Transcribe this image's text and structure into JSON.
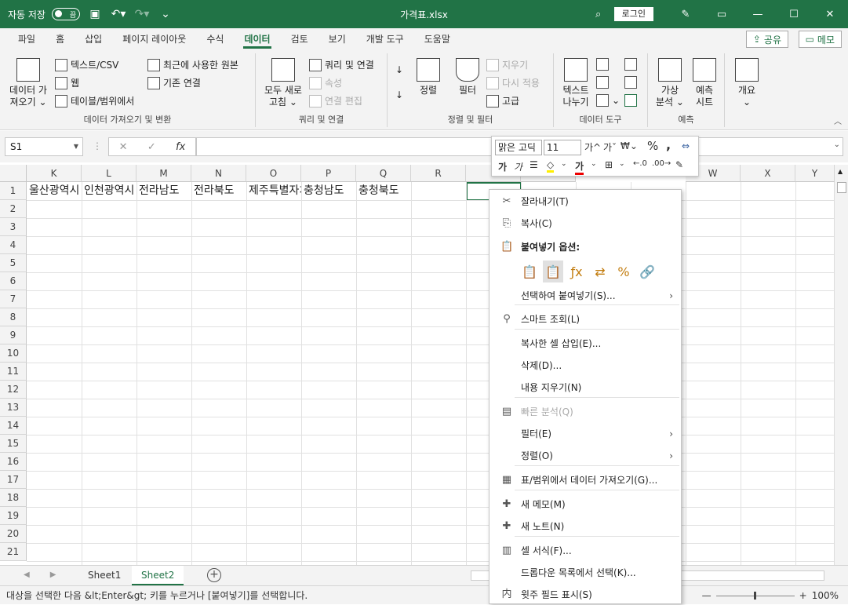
{
  "titlebar": {
    "autosave_label": "자동 저장",
    "autosave_state": "끔",
    "filename": "가격표.xlsx",
    "login": "로그인"
  },
  "tabs": [
    "파일",
    "홈",
    "삽입",
    "페이지 레이아웃",
    "수식",
    "데이터",
    "검토",
    "보기",
    "개발 도구",
    "도움말"
  ],
  "active_tab": "데이터",
  "share": "공유",
  "memo": "메모",
  "ribbon": {
    "get_data": "데이터 가\n져오기",
    "text_csv": "텍스트/CSV",
    "web": "웹",
    "table_range": "테이블/범위에서",
    "recent_sources": "최근에 사용한 원본",
    "existing_conn": "기존 연결",
    "group1": "데이터 가져오기 및 변환",
    "refresh_all": "모두 새로\n고침",
    "queries_conn": "쿼리 및 연결",
    "properties": "속성",
    "edit_links": "연결 편집",
    "group2": "쿼리 및 연결",
    "sort": "정렬",
    "filter": "필터",
    "clear": "지우기",
    "reapply": "다시 적용",
    "advanced": "고급",
    "group3": "정렬 및 필터",
    "text_to_cols": "텍스트\n나누기",
    "group4": "데이터 도구",
    "what_if": "가상\n분석",
    "forecast_sheet": "예측\n시트",
    "group5": "예측",
    "outline": "개요"
  },
  "formula_bar": {
    "name_box": "S1",
    "fx": "fx",
    "content": ""
  },
  "columns": [
    "K",
    "L",
    "M",
    "N",
    "O",
    "P",
    "Q",
    "R",
    "",
    "",
    "W",
    "X",
    "Y"
  ],
  "rows": [
    "1",
    "2",
    "3",
    "4",
    "5",
    "6",
    "7",
    "8",
    "9",
    "10",
    "11",
    "12",
    "13",
    "14",
    "15",
    "16",
    "17",
    "18",
    "19",
    "20",
    "21"
  ],
  "row1_values": [
    "울산광역시",
    "인천광역시",
    "전라남도",
    "전라북도",
    "제주특별자치도",
    "충청남도",
    "충청북도"
  ],
  "mini_toolbar": {
    "font": "맑은 고딕",
    "size": "11",
    "grow": "가^",
    "shrink": "가ˇ",
    "percent": "%",
    "comma": ",",
    "bold": "가",
    "italic": "가"
  },
  "context_menu": [
    {
      "label": "잘라내기(T)",
      "icon": "scissors-icon"
    },
    {
      "label": "복사(C)",
      "icon": "copy-icon"
    },
    {
      "label": "붙여넣기 옵션:",
      "icon": "paste-icon"
    },
    {
      "label": "선택하여 붙여넣기(S)...",
      "icon": ""
    },
    {
      "label": "스마트 조회(L)",
      "icon": "search-icon"
    },
    {
      "label": "복사한 셀 삽입(E)...",
      "icon": ""
    },
    {
      "label": "삭제(D)...",
      "icon": ""
    },
    {
      "label": "내용 지우기(N)",
      "icon": ""
    },
    {
      "label": "빠른 분석(Q)",
      "icon": "quick-analysis-icon"
    },
    {
      "label": "필터(E)",
      "icon": ""
    },
    {
      "label": "정렬(O)",
      "icon": ""
    },
    {
      "label": "표/범위에서 데이터 가져오기(G)...",
      "icon": "table-icon"
    },
    {
      "label": "새 메모(M)",
      "icon": "new-comment-icon"
    },
    {
      "label": "새 노트(N)",
      "icon": "new-note-icon"
    },
    {
      "label": "셀 서식(F)...",
      "icon": "format-cells-icon"
    },
    {
      "label": "드롭다운 목록에서 선택(K)...",
      "icon": ""
    },
    {
      "label": "윗주 필드 표시(S)",
      "icon": "phonetic-icon"
    }
  ],
  "sheets": [
    "Sheet1",
    "Sheet2"
  ],
  "active_sheet": "Sheet2",
  "status_text": "대상을 선택한 다음 &lt;Enter&gt; 키를 누르거나 [붙여넣기]를 선택합니다.",
  "zoom": "100%",
  "accent": "#217346"
}
